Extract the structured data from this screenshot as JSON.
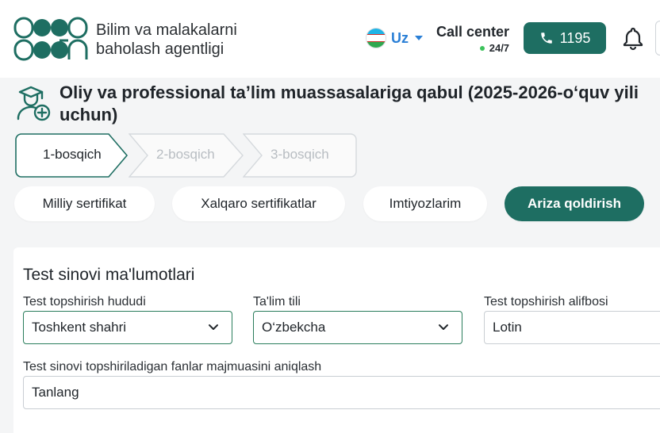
{
  "header": {
    "brand_line1": "Bilim va malakalarni",
    "brand_line2": "baholash agentligi",
    "language": "Uz",
    "call_center_title": "Call center",
    "call_center_hours": "24/7",
    "phone_number": "1195"
  },
  "page": {
    "title": "Oliy va professional ta’lim muassasalariga qabul (2025-2026-o‘quv yili uchun)"
  },
  "stepper": [
    {
      "label": "1-bosqich",
      "active": true
    },
    {
      "label": "2-bosqich",
      "active": false
    },
    {
      "label": "3-bosqich",
      "active": false
    }
  ],
  "tabs": [
    {
      "label": "Milliy sertifikat",
      "active": false
    },
    {
      "label": "Xalqaro sertifikatlar",
      "active": false
    },
    {
      "label": "Imtiyozlarim",
      "active": false
    },
    {
      "label": "Ariza qoldirish",
      "active": true
    }
  ],
  "form": {
    "section_title": "Test sinovi ma'lumotlari",
    "region": {
      "label": "Test topshirish hududi",
      "value": "Toshkent shahri"
    },
    "language": {
      "label": "Ta'lim tili",
      "value": "O‘zbekcha"
    },
    "alphabet": {
      "label": "Test topshirish alifbosi",
      "value": "Lotin"
    },
    "subjects": {
      "label": "Test sinovi topshiriladigan fanlar majmuasini aniqlash",
      "value": "Tanlang"
    }
  },
  "colors": {
    "brand_green": "#1e6e62",
    "link_blue": "#2a7fd6",
    "online_dot": "#3cc25b"
  },
  "icons": {
    "logo": "agency-logo",
    "flag": "uzbekistan-flag-icon",
    "phone": "phone-icon",
    "bell": "bell-icon",
    "title": "graduate-user-add-icon",
    "dropdown": "chevron-down-icon"
  }
}
